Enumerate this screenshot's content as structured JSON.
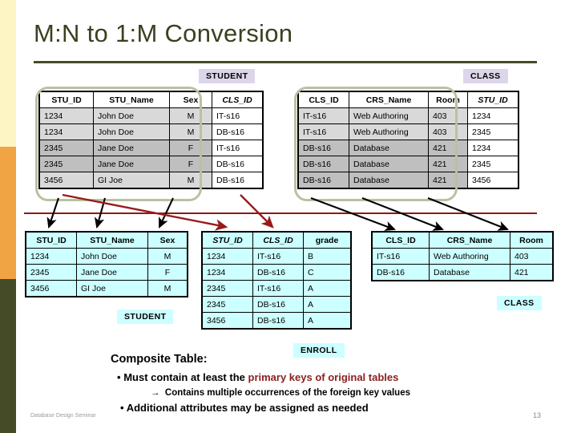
{
  "slide": {
    "title": "M:N to 1:M Conversion",
    "footer_left": "Database Design Seminar",
    "page_number": "13"
  },
  "colors": {
    "title": "#3b401f",
    "rule": "#454b27",
    "stripe_yellow": "#fdf5c4",
    "stripe_orange": "#f0a443",
    "stripe_olive": "#454b27",
    "header_red": "#8b2020",
    "header_blue": "#1a1ab4",
    "divider_red": "#8b1a1a",
    "chip_lavender": "#ddd6ea",
    "chip_cyan": "#ccffff",
    "pill_outline": "#b8c2a2"
  },
  "top_student": {
    "caption": "STUDENT",
    "columns": [
      "STU_ID",
      "STU_Name",
      "Sex",
      "CLS_ID"
    ],
    "rows": [
      [
        "1234",
        "John Doe",
        "M",
        "IT-s16"
      ],
      [
        "1234",
        "John Doe",
        "M",
        "DB-s16"
      ],
      [
        "2345",
        "Jane Doe",
        "F",
        "IT-s16"
      ],
      [
        "2345",
        "Jane Doe",
        "F",
        "DB-s16"
      ],
      [
        "3456",
        "GI  Joe",
        "M",
        "DB-s16"
      ]
    ]
  },
  "top_class": {
    "caption": "CLASS",
    "columns": [
      "CLS_ID",
      "CRS_Name",
      "Room",
      "STU_ID"
    ],
    "rows": [
      [
        "IT-s16",
        "Web Authoring",
        "403",
        "1234"
      ],
      [
        "IT-s16",
        "Web Authoring",
        "403",
        "2345"
      ],
      [
        "DB-s16",
        "Database",
        "421",
        "1234"
      ],
      [
        "DB-s16",
        "Database",
        "421",
        "2345"
      ],
      [
        "DB-s16",
        "Database",
        "421",
        "3456"
      ]
    ]
  },
  "bottom_student": {
    "caption": "STUDENT",
    "columns": [
      "STU_ID",
      "STU_Name",
      "Sex"
    ],
    "rows": [
      [
        "1234",
        "John Doe",
        "M"
      ],
      [
        "2345",
        "Jane Doe",
        "F"
      ],
      [
        "3456",
        "GI  Joe",
        "M"
      ]
    ]
  },
  "enroll": {
    "caption": "ENROLL",
    "columns": [
      "STU_ID",
      "CLS_ID",
      "grade"
    ],
    "rows": [
      [
        "1234",
        "IT-s16",
        "B"
      ],
      [
        "1234",
        "DB-s16",
        "C"
      ],
      [
        "2345",
        "IT-s16",
        "A"
      ],
      [
        "2345",
        "DB-s16",
        "A"
      ],
      [
        "3456",
        "DB-s16",
        "A"
      ]
    ]
  },
  "bottom_class": {
    "caption": "CLASS",
    "columns": [
      "CLS_ID",
      "CRS_Name",
      "Room"
    ],
    "rows": [
      [
        "IT-s16",
        "Web Authoring",
        "403"
      ],
      [
        "DB-s16",
        "Database",
        "421"
      ]
    ]
  },
  "notes": {
    "heading": "Composite Table:",
    "bullet1_pre": "Must contain at least the ",
    "bullet1_red": "primary keys of original tables",
    "sub_arrow": "→",
    "sub_text": "Contains multiple occurrences of the foreign key values",
    "bullet2": "Additional attributes may be assigned as needed",
    "bullet_glyph": "•"
  }
}
